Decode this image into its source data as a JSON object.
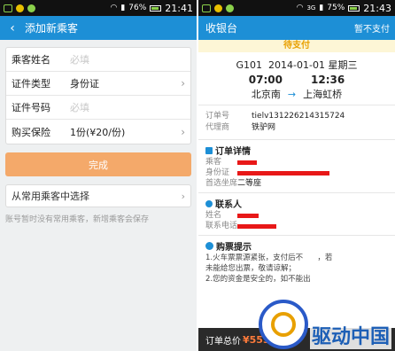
{
  "left": {
    "status": {
      "battery": "76%",
      "time": "21:41"
    },
    "appbar": {
      "back": "‹",
      "title": "添加新乘客"
    },
    "form": [
      {
        "label": "乘客姓名",
        "placeholder": "必填",
        "value": "",
        "chevron": false
      },
      {
        "label": "证件类型",
        "placeholder": "",
        "value": "身份证",
        "chevron": true
      },
      {
        "label": "证件号码",
        "placeholder": "必填",
        "value": "",
        "chevron": false
      },
      {
        "label": "购买保险",
        "placeholder": "",
        "value": "1份(¥20/份)",
        "chevron": true
      }
    ],
    "done_label": "完成",
    "choose_label": "从常用乘客中选择",
    "hint": "账号暂时没有常用乘客，新增乘客会保存"
  },
  "right": {
    "status": {
      "network": "3G",
      "battery": "75%",
      "time": "21:43"
    },
    "appbar": {
      "title": "收银台",
      "action": "暂不支付"
    },
    "pending": "待支付",
    "trip": {
      "train": "G101",
      "date": "2014-01-01",
      "weekday": "星期三",
      "depart_time": "07:00",
      "arrive_time": "12:36",
      "from": "北京南",
      "to": "上海虹桥"
    },
    "order": {
      "no_label": "订单号",
      "no_value": "tielv131226214315724",
      "agent_label": "代理商",
      "agent_value": "铁驴网"
    },
    "detail": {
      "title": "订单详情",
      "passenger_label": "乘客",
      "id_label": "身份证",
      "seat_label": "首选坐席",
      "seat_value": "二等座"
    },
    "contact": {
      "title": "联系人",
      "name_label": "姓名",
      "phone_label": "联系电话"
    },
    "tips": {
      "title": "购票提示",
      "line1": "1.火车票票源紧张，支付后不",
      "line1b": "，若",
      "line2": "未能给您出票，敬请谅解；",
      "line3": "2.您的资金是安全的，如不能出"
    },
    "footer": {
      "label": "订单总价",
      "price": "¥553"
    }
  },
  "watermark": {
    "text": "驱动中国"
  },
  "colors": {
    "accent": "#1d8fd6",
    "done": "#f4a96a",
    "pending": "#e8a000",
    "price": "#ff7b3b",
    "redact": "#e81818"
  }
}
